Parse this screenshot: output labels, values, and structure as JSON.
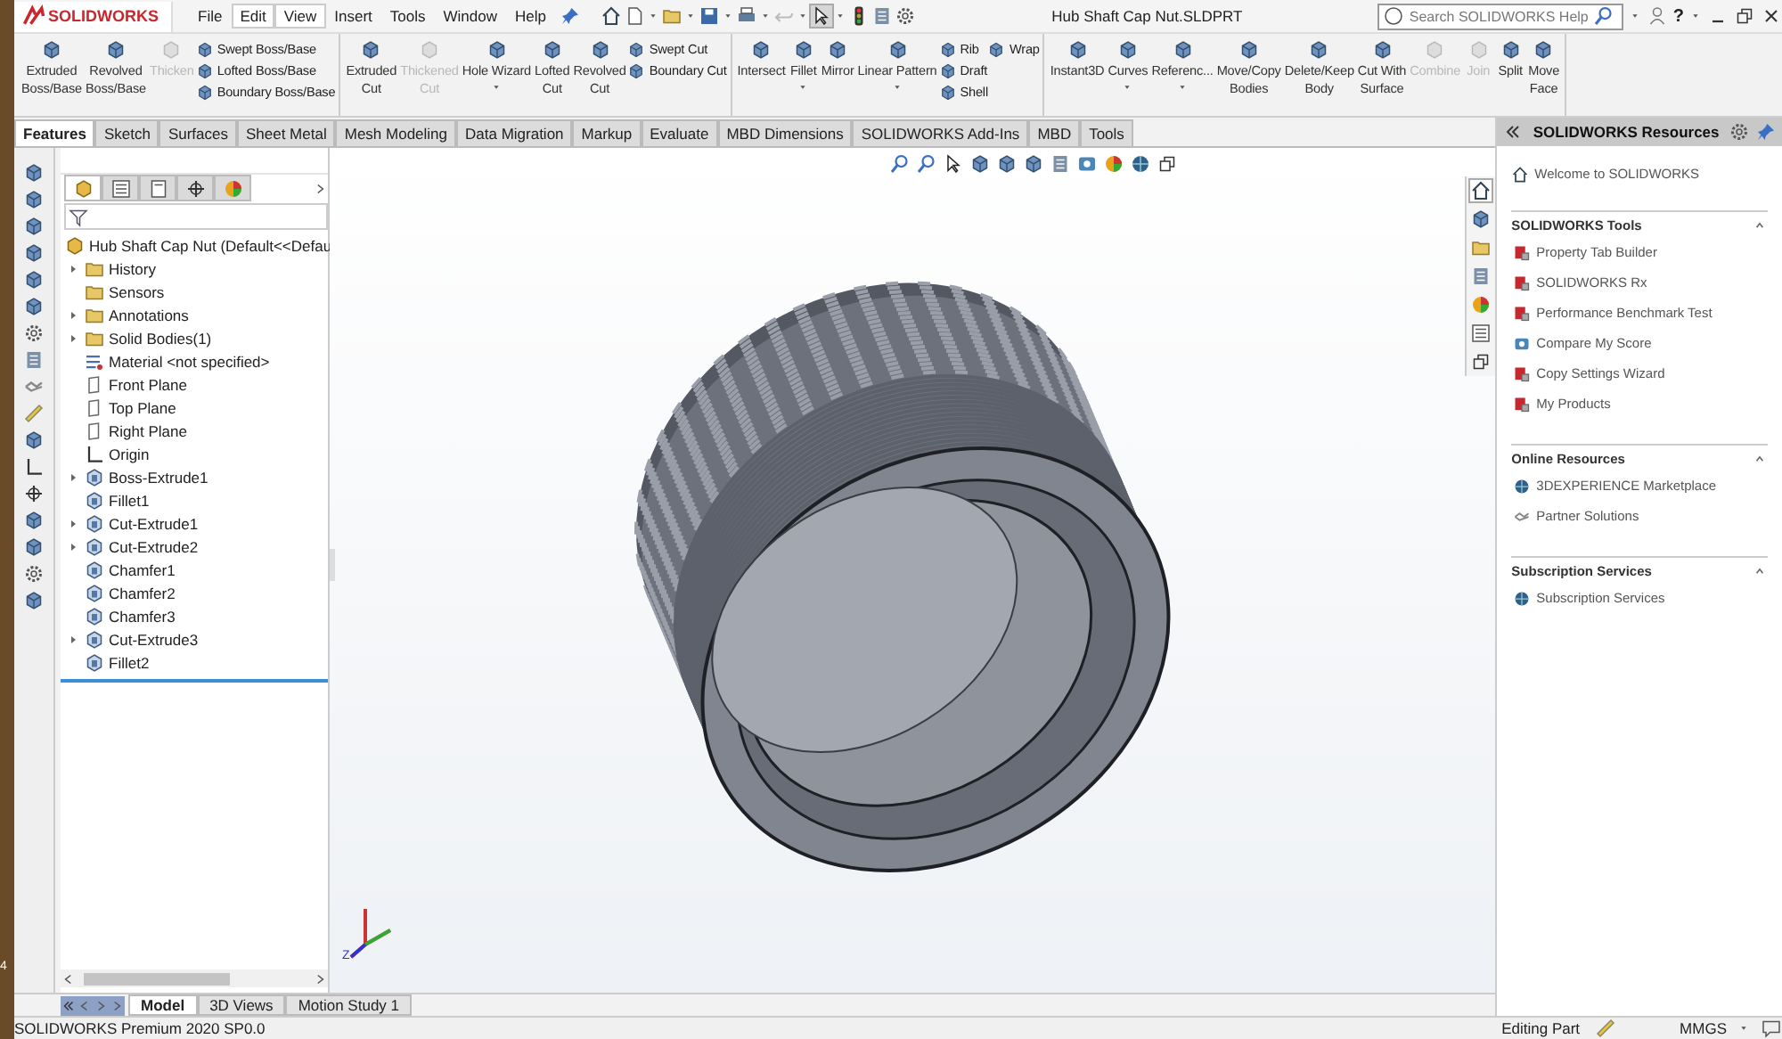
{
  "desktop": {
    "edge_text": "4"
  },
  "logo": {
    "text": "SOLIDWORKS"
  },
  "menu": [
    {
      "label": "File",
      "selected": false
    },
    {
      "label": "Edit",
      "selected": true
    },
    {
      "label": "View",
      "selected": true
    },
    {
      "label": "Insert",
      "selected": false
    },
    {
      "label": "Tools",
      "selected": false
    },
    {
      "label": "Window",
      "selected": false
    },
    {
      "label": "Help",
      "selected": false
    }
  ],
  "window": {
    "title": "Hub Shaft Cap Nut.SLDPRT"
  },
  "search": {
    "placeholder": "Search SOLIDWORKS Help"
  },
  "help": {
    "label": "?"
  },
  "ribbon": [
    {
      "commands": [
        {
          "kind": "large",
          "label": "Extruded\nBoss/Base",
          "disabled": false,
          "dropdown": false
        },
        {
          "kind": "large",
          "label": "Revolved\nBoss/Base",
          "disabled": false,
          "dropdown": false
        },
        {
          "kind": "large",
          "label": "Thicken",
          "disabled": true,
          "dropdown": false
        },
        {
          "kind": "stack",
          "items": [
            "Swept Boss/Base",
            "Lofted Boss/Base",
            "Boundary Boss/Base"
          ]
        }
      ]
    },
    {
      "commands": [
        {
          "kind": "large",
          "label": "Extruded\nCut",
          "disabled": false,
          "dropdown": false
        },
        {
          "kind": "large",
          "label": "Thickened\nCut",
          "disabled": true,
          "dropdown": false
        },
        {
          "kind": "large",
          "label": "Hole Wizard",
          "disabled": false,
          "dropdown": true
        },
        {
          "kind": "large",
          "label": "Lofted\nCut",
          "disabled": false,
          "dropdown": false
        },
        {
          "kind": "large",
          "label": "Revolved\nCut",
          "disabled": false,
          "dropdown": false
        },
        {
          "kind": "stack",
          "items": [
            "Swept Cut",
            "Boundary Cut"
          ]
        }
      ]
    },
    {
      "commands": [
        {
          "kind": "large",
          "label": "Intersect",
          "disabled": false,
          "dropdown": false
        },
        {
          "kind": "large",
          "label": "Fillet",
          "disabled": false,
          "dropdown": true
        },
        {
          "kind": "large",
          "label": "Mirror",
          "disabled": false,
          "dropdown": false
        },
        {
          "kind": "large",
          "label": "Linear Pattern",
          "disabled": false,
          "dropdown": true
        },
        {
          "kind": "stack",
          "items": [
            "Rib",
            "Draft",
            "Shell"
          ]
        },
        {
          "kind": "stack",
          "items": [
            "Wrap"
          ]
        }
      ]
    },
    {
      "commands": [
        {
          "kind": "large",
          "label": "Instant3D",
          "disabled": false,
          "dropdown": false
        },
        {
          "kind": "large",
          "label": "Curves",
          "disabled": false,
          "dropdown": true
        },
        {
          "kind": "large",
          "label": "Referenc...",
          "disabled": false,
          "dropdown": true
        },
        {
          "kind": "large",
          "label": "Move/Copy\nBodies",
          "disabled": false,
          "dropdown": false
        },
        {
          "kind": "large",
          "label": "Delete/Keep\nBody",
          "disabled": false,
          "dropdown": false
        },
        {
          "kind": "large",
          "label": "Cut With\nSurface",
          "disabled": false,
          "dropdown": false
        },
        {
          "kind": "large",
          "label": "Combine",
          "disabled": true,
          "dropdown": false
        },
        {
          "kind": "large",
          "label": "Join",
          "disabled": true,
          "dropdown": false
        },
        {
          "kind": "large",
          "label": "Split",
          "disabled": false,
          "dropdown": false
        },
        {
          "kind": "large",
          "label": "Move\nFace",
          "disabled": false,
          "dropdown": false
        }
      ]
    }
  ],
  "command_tabs": [
    {
      "label": "Features",
      "selected": true
    },
    {
      "label": "Sketch",
      "selected": false
    },
    {
      "label": "Surfaces",
      "selected": false
    },
    {
      "label": "Sheet Metal",
      "selected": false
    },
    {
      "label": "Mesh Modeling",
      "selected": false
    },
    {
      "label": "Data Migration",
      "selected": false
    },
    {
      "label": "Markup",
      "selected": false
    },
    {
      "label": "Evaluate",
      "selected": false
    },
    {
      "label": "MBD Dimensions",
      "selected": false
    },
    {
      "label": "SOLIDWORKS Add-Ins",
      "selected": false
    },
    {
      "label": "MBD",
      "selected": false
    },
    {
      "label": "Tools",
      "selected": false
    }
  ],
  "tree_panel_tabs": [
    {
      "selected": true
    },
    {
      "selected": false
    },
    {
      "selected": false
    },
    {
      "selected": false
    },
    {
      "selected": false
    }
  ],
  "tree": {
    "root": "Hub Shaft Cap Nut (Default<<Defau",
    "items": [
      {
        "label": "History",
        "kind": "folder",
        "expandable": true
      },
      {
        "label": "Sensors",
        "kind": "folder",
        "expandable": false
      },
      {
        "label": "Annotations",
        "kind": "folder",
        "expandable": true
      },
      {
        "label": "Solid Bodies(1)",
        "kind": "folder",
        "expandable": true
      },
      {
        "label": "Material <not specified>",
        "kind": "material",
        "expandable": false
      },
      {
        "label": "Front Plane",
        "kind": "plane",
        "expandable": false
      },
      {
        "label": "Top Plane",
        "kind": "plane",
        "expandable": false
      },
      {
        "label": "Right Plane",
        "kind": "plane",
        "expandable": false
      },
      {
        "label": "Origin",
        "kind": "origin",
        "expandable": false
      },
      {
        "label": "Boss-Extrude1",
        "kind": "feature",
        "expandable": true
      },
      {
        "label": "Fillet1",
        "kind": "feature",
        "expandable": false
      },
      {
        "label": "Cut-Extrude1",
        "kind": "feature",
        "expandable": true
      },
      {
        "label": "Cut-Extrude2",
        "kind": "feature",
        "expandable": true
      },
      {
        "label": "Chamfer1",
        "kind": "feature",
        "expandable": false
      },
      {
        "label": "Chamfer2",
        "kind": "feature",
        "expandable": false
      },
      {
        "label": "Chamfer3",
        "kind": "feature",
        "expandable": false
      },
      {
        "label": "Cut-Extrude3",
        "kind": "feature",
        "expandable": true
      },
      {
        "label": "Fillet2",
        "kind": "feature",
        "expandable": false
      }
    ]
  },
  "viewport": {
    "triad_label": "Z"
  },
  "resources": {
    "title": "SOLIDWORKS Resources",
    "welcome": "Welcome to SOLIDWORKS",
    "sections": [
      {
        "title": "SOLIDWORKS Tools",
        "items": [
          "Property Tab Builder",
          "SOLIDWORKS Rx",
          "Performance Benchmark Test",
          "Compare My Score",
          "Copy Settings Wizard",
          "My Products"
        ]
      },
      {
        "title": "Online Resources",
        "items": [
          "3DEXPERIENCE Marketplace",
          "Partner Solutions"
        ]
      },
      {
        "title": "Subscription Services",
        "items": [
          "Subscription Services"
        ]
      }
    ]
  },
  "bottom_tabs": [
    {
      "label": "Model",
      "selected": true
    },
    {
      "label": "3D Views",
      "selected": false
    },
    {
      "label": "Motion Study 1",
      "selected": false
    }
  ],
  "status_bar": {
    "product": "SOLIDWORKS Premium 2020 SP0.0",
    "mode": "Editing Part",
    "units": "MMGS"
  }
}
